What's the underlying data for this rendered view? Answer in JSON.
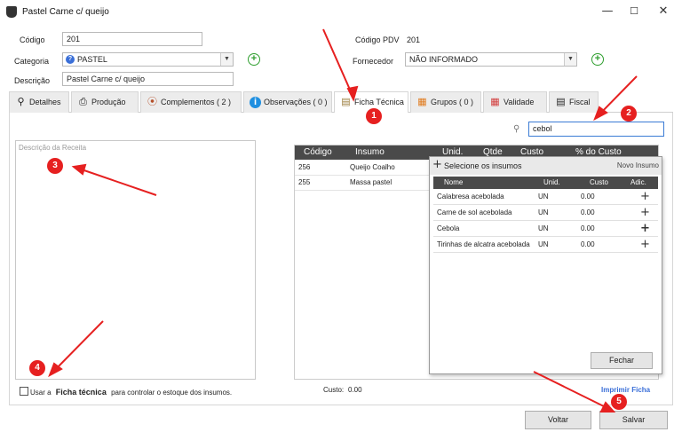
{
  "window": {
    "title": "Pastel Carne c/ queijo"
  },
  "form": {
    "codigo_label": "Código",
    "codigo_value": "201",
    "categoria_label": "Categoria",
    "categoria_value": "PASTEL",
    "descricao_label": "Descrição",
    "descricao_value": "Pastel Carne c/ queijo",
    "codigo_pdv_label": "Código PDV",
    "codigo_pdv_value": "201",
    "fornecedor_label": "Fornecedor",
    "fornecedor_value": "NÃO INFORMADO"
  },
  "tabs": [
    {
      "label": "Detalhes",
      "icon": "search-icon"
    },
    {
      "label": "Produção",
      "icon": "printer-icon"
    },
    {
      "label": "Complementos ( 2 )",
      "icon": "sausage-icon"
    },
    {
      "label": "Observações ( 0 )",
      "icon": "info-icon"
    },
    {
      "label": "Ficha Técnica",
      "icon": "clipboard-icon"
    },
    {
      "label": "Grupos ( 0 )",
      "icon": "groups-icon"
    },
    {
      "label": "Validade",
      "icon": "calendar-icon"
    },
    {
      "label": "Fiscal",
      "icon": "document-icon"
    }
  ],
  "ficha": {
    "search_value": "cebol",
    "recipe_placeholder": "Descrição da Receita",
    "columns": [
      "Código",
      "Insumo",
      "Unid.",
      "Qtde",
      "Custo",
      "% do Custo"
    ],
    "rows": [
      {
        "codigo": "256",
        "insumo": "Queijo Coalho"
      },
      {
        "codigo": "255",
        "insumo": "Massa pastel"
      }
    ],
    "use_checkbox_prefix": "Usar a",
    "use_checkbox_bold": "Ficha técnica",
    "use_checkbox_suffix": "para controlar o estoque dos insumos.",
    "custo_label": "Custo:",
    "custo_value": "0.00",
    "imprimir_label": "Imprimir Ficha"
  },
  "popup": {
    "title": "Selecione os insumos",
    "novo_label": "Novo Insumo",
    "columns": [
      "Nome",
      "Unid.",
      "Custo",
      "Adic."
    ],
    "rows": [
      {
        "nome": "Calabresa acebolada",
        "unid": "UN",
        "custo": "0.00"
      },
      {
        "nome": "Carne de sol acebolada",
        "unid": "UN",
        "custo": "0.00"
      },
      {
        "nome": "Cebola",
        "unid": "UN",
        "custo": "0.00"
      },
      {
        "nome": "Tirinhas de alcatra acebolada",
        "unid": "UN",
        "custo": "0.00"
      }
    ],
    "fechar_label": "Fechar"
  },
  "footer": {
    "voltar_label": "Voltar",
    "salvar_label": "Salvar"
  },
  "annotations": [
    "1",
    "2",
    "3",
    "4",
    "5"
  ],
  "colors": {
    "annotation_red": "#e62020",
    "header_dark": "#4a4a4a",
    "add_green": "#2e9e2e",
    "link_blue": "#3a6fd8"
  }
}
